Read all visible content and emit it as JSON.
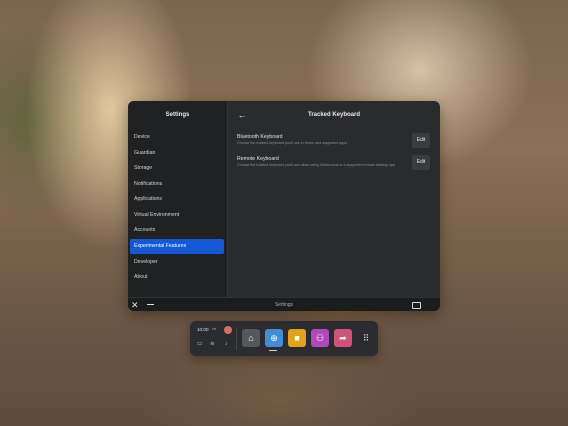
{
  "sidebar": {
    "title": "Settings",
    "items": [
      {
        "label": "Device"
      },
      {
        "label": "Guardian"
      },
      {
        "label": "Storage"
      },
      {
        "label": "Notifications"
      },
      {
        "label": "Applications"
      },
      {
        "label": "Virtual Environment"
      },
      {
        "label": "Accounts"
      },
      {
        "label": "Experimental Features",
        "active": true
      },
      {
        "label": "Developer"
      },
      {
        "label": "About"
      }
    ]
  },
  "main": {
    "title": "Tracked Keyboard",
    "rows": [
      {
        "title": "Bluetooth Keyboard",
        "description": "Choose the tracked keyboard you'll use in Home and supported apps",
        "button": "Edit"
      },
      {
        "title": "Remote Keyboard",
        "description": "Choose the tracked keyboard you'll use when using Workrooms or a supported remote desktop app",
        "button": "Edit"
      }
    ]
  },
  "bottom_bar": {
    "title": "Settings"
  },
  "dock": {
    "time": "10:00",
    "ampm": "PM",
    "apps": [
      {
        "name": "home",
        "color": "#55575b",
        "glyph": "⌂"
      },
      {
        "name": "explore",
        "color": "#3f8ed6",
        "glyph": "⊕"
      },
      {
        "name": "store",
        "color": "#e2a21a",
        "glyph": "■"
      },
      {
        "name": "people",
        "color": "#b04ab9",
        "glyph": "⚇"
      },
      {
        "name": "share",
        "color": "#d2527a",
        "glyph": "➦"
      },
      {
        "name": "app-library",
        "color": "#2b2c2f",
        "glyph": "⠿"
      }
    ]
  }
}
